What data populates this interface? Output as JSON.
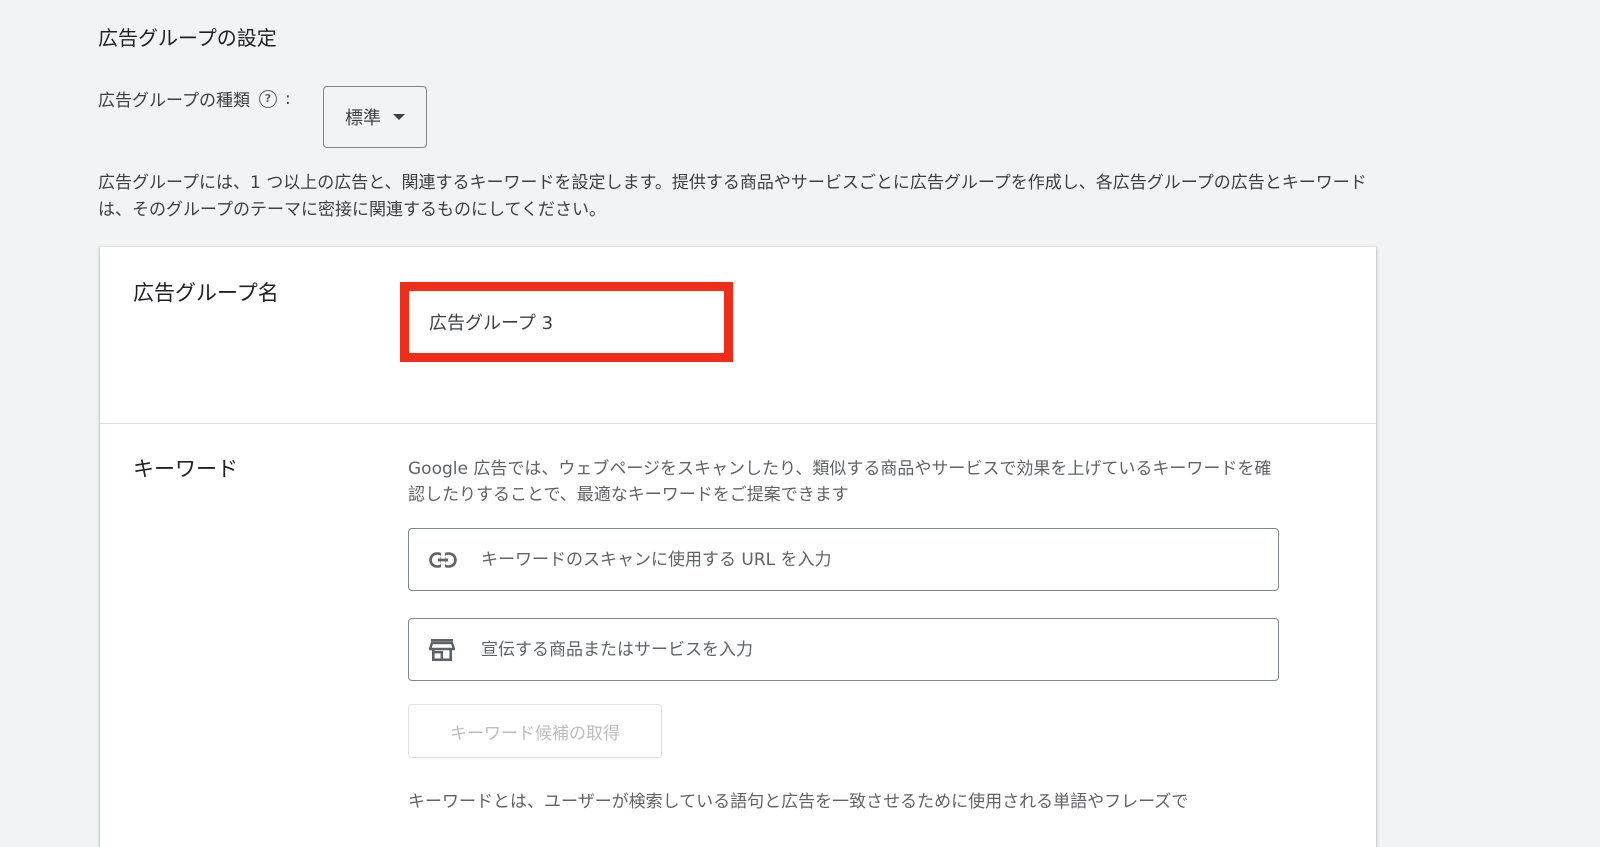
{
  "section": {
    "title": "広告グループの設定"
  },
  "ad_group_type": {
    "label": "広告グループの種類",
    "help_icon": "?",
    "colon": ":",
    "selected": "標準"
  },
  "description": "広告グループには、1 つ以上の広告と、関連するキーワードを設定します。提供する商品やサービスごとに広告グループを作成し、各広告グループの広告とキーワードは、そのグループのテーマに密接に関連するものにしてください。",
  "ad_group_name": {
    "label": "広告グループ名",
    "value": "広告グループ 3",
    "highlight_color": "#ef2d1b"
  },
  "keywords": {
    "label": "キーワード",
    "description": "Google 広告では、ウェブページをスキャンしたり、類似する商品やサービスで効果を上げているキーワードを確認したりすることで、最適なキーワードをご提案できます",
    "url_field": {
      "icon": "link-icon",
      "placeholder": "キーワードのスキャンに使用する URL を入力"
    },
    "product_field": {
      "icon": "store-icon",
      "placeholder": "宣伝する商品またはサービスを入力"
    },
    "get_button_label": "キーワード候補の取得",
    "bottom_text": "キーワードとは、ユーザーが検索している語句と広告を一致させるために使用される単語やフレーズで"
  }
}
